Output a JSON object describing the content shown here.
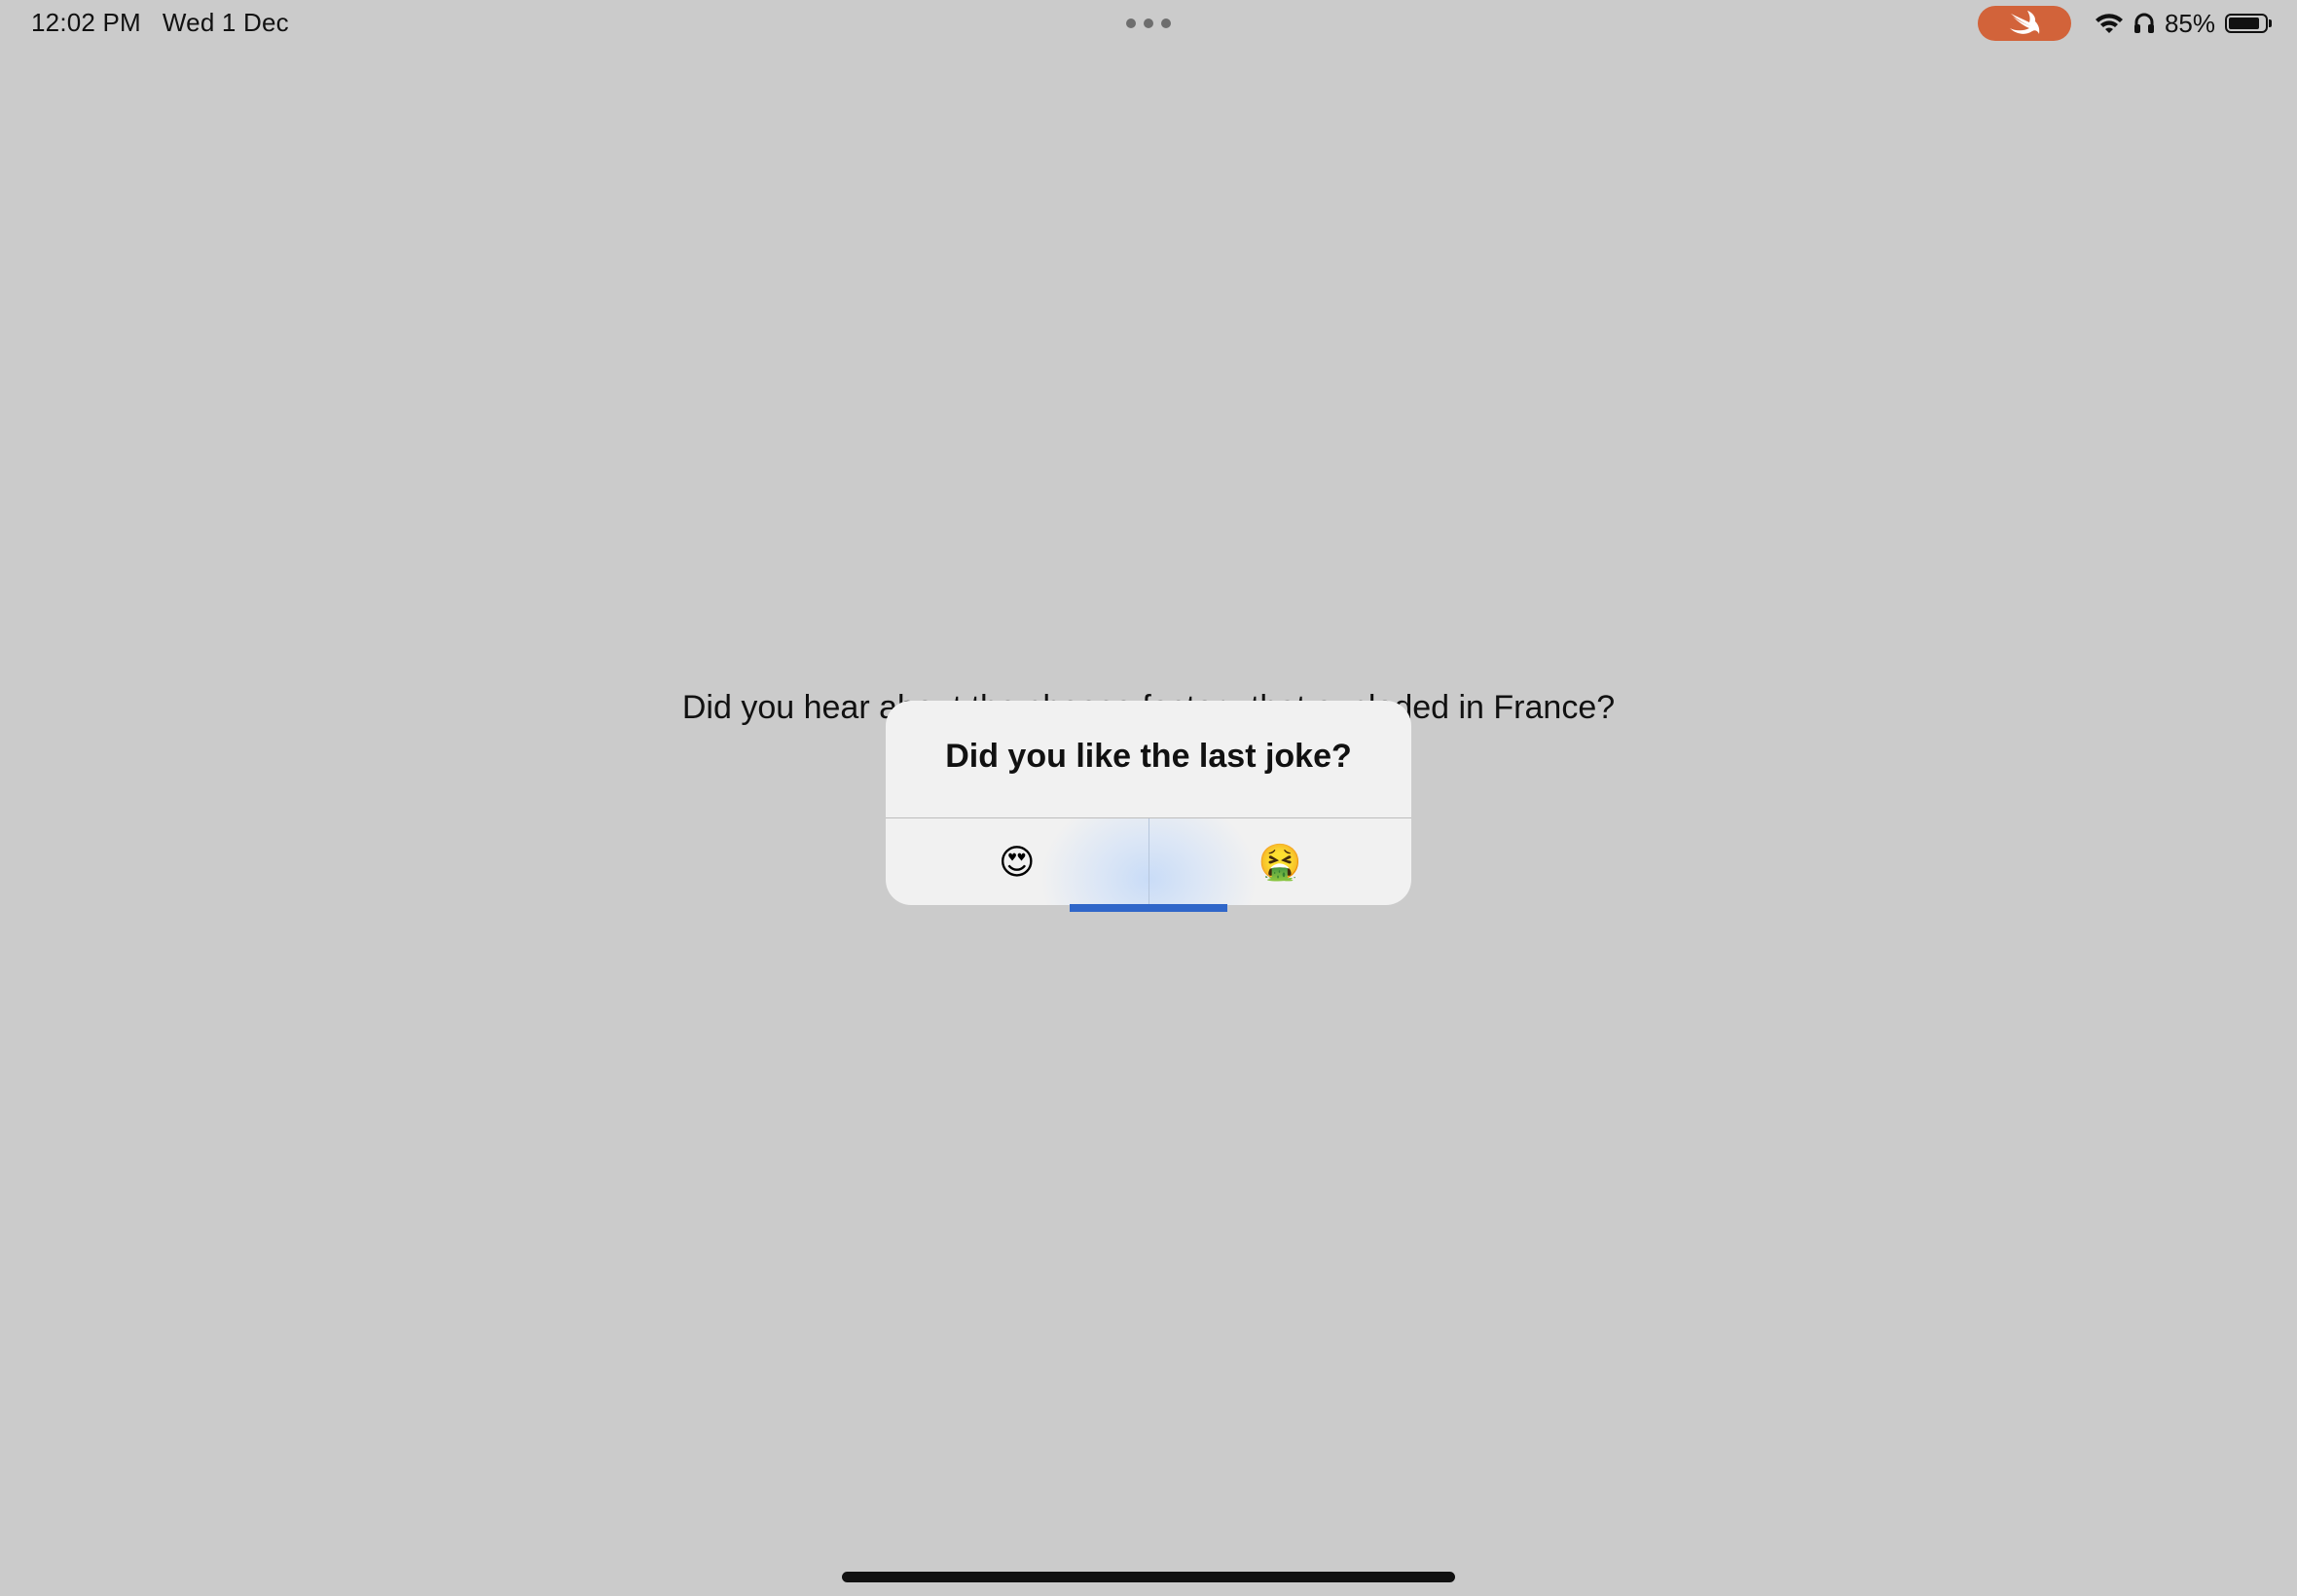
{
  "status_bar": {
    "time": "12:02 PM",
    "date": "Wed 1 Dec",
    "battery_percent": "85%",
    "battery_level": 0.85,
    "swift_pill_color": "#d2633a",
    "icons": [
      "swift-icon",
      "wifi-icon",
      "headphones-icon",
      "battery-icon"
    ]
  },
  "main": {
    "joke_text": "Did you hear about the cheese factory that exploded in France?"
  },
  "alert": {
    "title": "Did you like the last joke?",
    "buttons": [
      {
        "label": "😍"
      },
      {
        "label": "🤮"
      }
    ],
    "focus_color": "#2f66c9"
  }
}
